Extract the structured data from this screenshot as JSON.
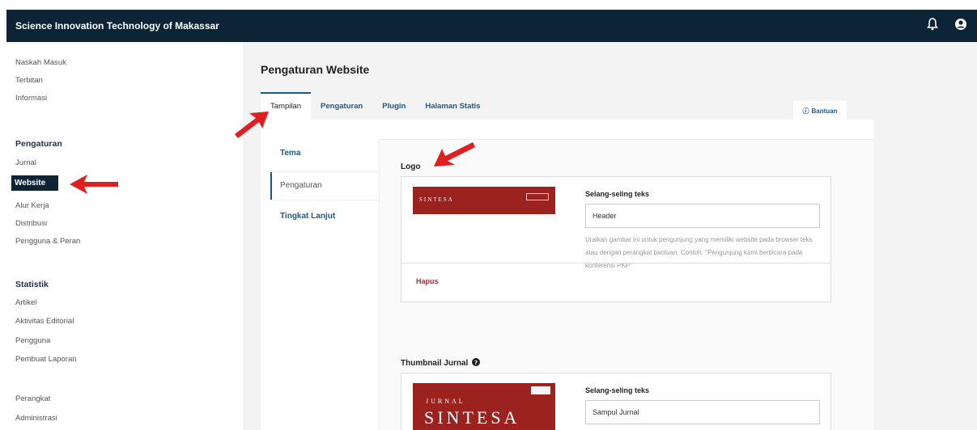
{
  "header": {
    "site_title": "Science Innovation Technology of Makassar",
    "icons": [
      "bell-icon",
      "user-circle-icon"
    ]
  },
  "sidebar": {
    "top_links": [
      "Naskah Masuk",
      "Terbitan",
      "Informasi"
    ],
    "settings_heading": "Pengaturan",
    "settings_links": [
      "Jurnal",
      "Website",
      "Alur Kerja",
      "Distribusi",
      "Pengguna & Peran"
    ],
    "active_link": "Website",
    "stats_heading": "Statistik",
    "stats_links": [
      "Artikel",
      "Aktivitas Editorial",
      "Pengguna",
      "Pembuat Laporan"
    ],
    "tools_links": [
      "Perangkat",
      "Administrasi"
    ]
  },
  "main": {
    "page_title": "Pengaturan Website",
    "tabs": [
      "Tampilan",
      "Pengaturan",
      "Plugin",
      "Halaman Statis"
    ],
    "active_tab": "Tampilan",
    "help_label": "Bantuan",
    "subnav": [
      "Tema",
      "Pengaturan",
      "Tingkat Lanjut"
    ],
    "active_subnav": "Pengaturan"
  },
  "logo_section": {
    "label": "Logo",
    "thumb_text": "SINTESA",
    "alt_label": "Selang-seling teks",
    "alt_value": "Header",
    "description": "Uraikan gambar ini untuk pengunjung yang memiliki website pada browser teks atau dengan perangkat bantuan. Contoh: \"Pengunjung kami berbicara pada konferensi PKP\"",
    "delete_label": "Hapus"
  },
  "thumbnail_section": {
    "label": "Thumbnail Jurnal",
    "thumb_text_small": "JURNAL",
    "thumb_text_large": "SINTESA",
    "alt_label": "Selang-seling teks",
    "alt_value": "Sampul Jurnal"
  },
  "colors": {
    "header_bg": "#0d2436",
    "accent": "#1a5a8a",
    "brand_red": "#9c2220",
    "annotation_arrow": "#e02020"
  }
}
